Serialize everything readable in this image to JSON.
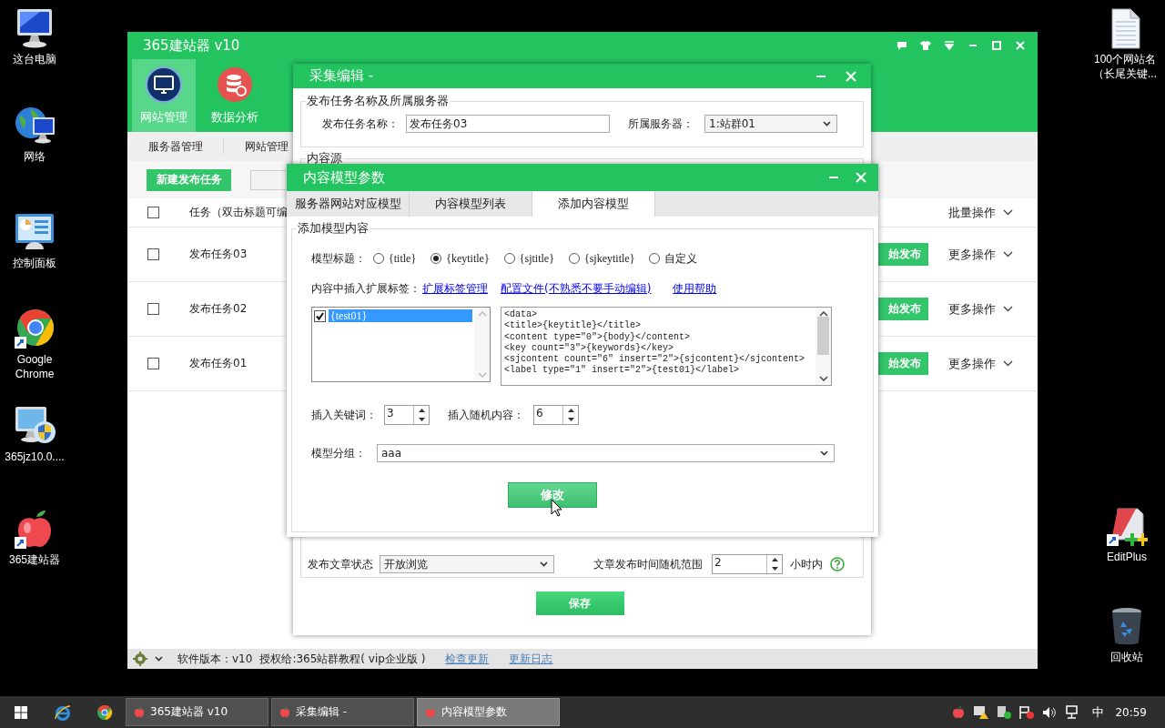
{
  "desktop_icons": [
    {
      "label": "这台电脑",
      "kind": "computer"
    },
    {
      "label": "网络",
      "kind": "network"
    },
    {
      "label": "控制面板",
      "kind": "panel"
    },
    {
      "label": "Google Chrome",
      "kind": "chrome"
    },
    {
      "label": "365jz10.0....",
      "kind": "installer"
    },
    {
      "label": "365建站器",
      "kind": "apple"
    },
    {
      "label": "100个网站名（长尾关键...",
      "kind": "file"
    },
    {
      "label": "EditPlus",
      "kind": "editplus"
    },
    {
      "label": "回收站",
      "kind": "recycle"
    }
  ],
  "main_window": {
    "title": "365建站器 v10",
    "tools": [
      {
        "label": "网站管理",
        "kind": "monitor",
        "selected": true
      },
      {
        "label": "数据分析",
        "kind": "database",
        "selected": false
      }
    ],
    "subnav": [
      "服务器管理",
      "网站管理"
    ],
    "new_button": "新建发布任务",
    "header": {
      "label": "任务（双击标题可编",
      "checked": false,
      "batch": "批量操作"
    },
    "rows": [
      {
        "name": "发布任务03",
        "checked": false,
        "publish": "始发布",
        "more": "更多操作"
      },
      {
        "name": "发布任务02",
        "checked": false,
        "publish": "始发布",
        "more": "更多操作"
      },
      {
        "name": "发布任务01",
        "checked": false,
        "publish": "始发布",
        "more": "更多操作"
      }
    ],
    "status_bar": {
      "version": "软件版本：v10",
      "license": "授权给:365站群教程( vip企业版 )",
      "links": [
        "检查更新",
        "更新日志"
      ]
    }
  },
  "collect_window": {
    "title": "采集编辑 -",
    "group1": "发布任务名称及所属服务器",
    "name_label": "发布任务名称：",
    "name_value": "发布任务03",
    "server_label": "所属服务器：",
    "server_value": "1:站群01",
    "group2": "内容源",
    "status_label": "发布文章状态",
    "status_value": "开放浏览",
    "range_label": "文章发布时间随机范围",
    "range_value": "2",
    "range_unit": "小时内",
    "save": "保存"
  },
  "model_dialog": {
    "title": "内容模型参数",
    "tabs": [
      {
        "label": "服务器网站对应模型",
        "selected": false
      },
      {
        "label": "内容模型列表",
        "selected": false
      },
      {
        "label": "添加内容模型",
        "selected": true
      }
    ],
    "group": "添加模型内容",
    "title_label": "模型标题：",
    "radios": [
      {
        "label": "{title}",
        "selected": false
      },
      {
        "label": "{keytitle}",
        "selected": true
      },
      {
        "label": "{sjtitle}",
        "selected": false
      },
      {
        "label": "{sjkeytitle}",
        "selected": false
      },
      {
        "label": "自定义",
        "selected": false
      }
    ],
    "tags_label": "内容中插入扩展标签：",
    "links": [
      "扩展标签管理",
      "配置文件(不熟悉不要手动编辑)",
      "使用帮助"
    ],
    "tag_list": [
      {
        "label": "{test01}",
        "checked": true,
        "selected": true
      }
    ],
    "template": [
      "<data>",
      "<title>{keytitle}</title>",
      "<content type=\"0\">{body}</content>",
      "<key count=\"3\">{keywords}</key>",
      "<sjcontent count=\"6\" insert=\"2\">{sjcontent}</sjcontent>",
      "<label type=\"1\" insert=\"2\">{test01}</label>"
    ],
    "keyword_label": "插入关键词：",
    "keyword_value": "3",
    "random_label": "插入随机内容：",
    "random_value": "6",
    "group_label": "模型分组：",
    "group_value": "aaa",
    "submit": "修改"
  },
  "taskbar": {
    "tasks": [
      {
        "label": "365建站器 v10",
        "selected": false
      },
      {
        "label": "采集编辑 -",
        "selected": false
      },
      {
        "label": "内容模型参数",
        "selected": true
      }
    ],
    "ime": "中",
    "clock": "20:59"
  }
}
